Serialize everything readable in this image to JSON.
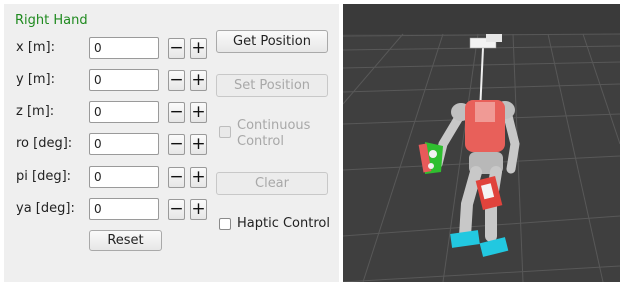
{
  "panel": {
    "title": "Right Hand",
    "rows": [
      {
        "label": "x [m]:",
        "value": "0"
      },
      {
        "label": "y [m]:",
        "value": "0"
      },
      {
        "label": "z [m]:",
        "value": "0"
      },
      {
        "label": "ro [deg]:",
        "value": "0"
      },
      {
        "label": "pi [deg]:",
        "value": "0"
      },
      {
        "label": "ya [deg]:",
        "value": "0"
      }
    ],
    "minus_label": "−",
    "plus_label": "+",
    "reset_label": "Reset"
  },
  "actions": {
    "get_position": "Get Position",
    "set_position": "Set Position",
    "continuous_control": "Continuous Control",
    "clear": "Clear",
    "haptic_control": "Haptic Control"
  },
  "viewport": {
    "background_color": "#3f3f3f",
    "grid_color": "#5a5a5a",
    "robot_body_color": "#c8c8c8",
    "robot_torso_color": "#e8605a",
    "robot_feet_color": "#22c8e0",
    "hand_marker_color": "#2fbf2f"
  }
}
